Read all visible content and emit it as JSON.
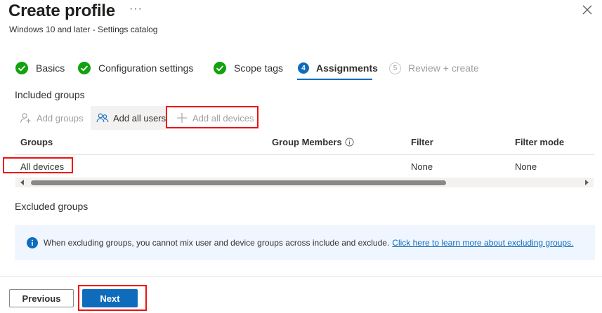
{
  "header": {
    "title": "Create profile",
    "more_label": "···",
    "subtitle": "Windows 10 and later - Settings catalog"
  },
  "steps": [
    {
      "label": "Basics",
      "state": "complete"
    },
    {
      "label": "Configuration settings",
      "state": "complete"
    },
    {
      "label": "Scope tags",
      "state": "complete"
    },
    {
      "number": "4",
      "label": "Assignments",
      "state": "active"
    },
    {
      "number": "5",
      "label": "Review + create",
      "state": "disabled"
    }
  ],
  "included": {
    "label": "Included groups",
    "commands": {
      "add_groups": "Add groups",
      "add_all_users": "Add all users",
      "add_all_devices": "Add all devices"
    },
    "columns": [
      "Groups",
      "Group Members",
      "Filter",
      "Filter mode"
    ],
    "rows": [
      {
        "group": "All devices",
        "members": "",
        "filter": "None",
        "filter_mode": "None"
      }
    ]
  },
  "excluded": {
    "label": "Excluded groups",
    "info_text": "When excluding groups, you cannot mix user and device groups across include and exclude.",
    "info_link": "Click here to learn more about excluding groups."
  },
  "footer": {
    "previous_label": "Previous",
    "next_label": "Next"
  },
  "colors": {
    "accent": "#0f6cbd",
    "success": "#13a10e",
    "highlight_box": "#e11111"
  }
}
